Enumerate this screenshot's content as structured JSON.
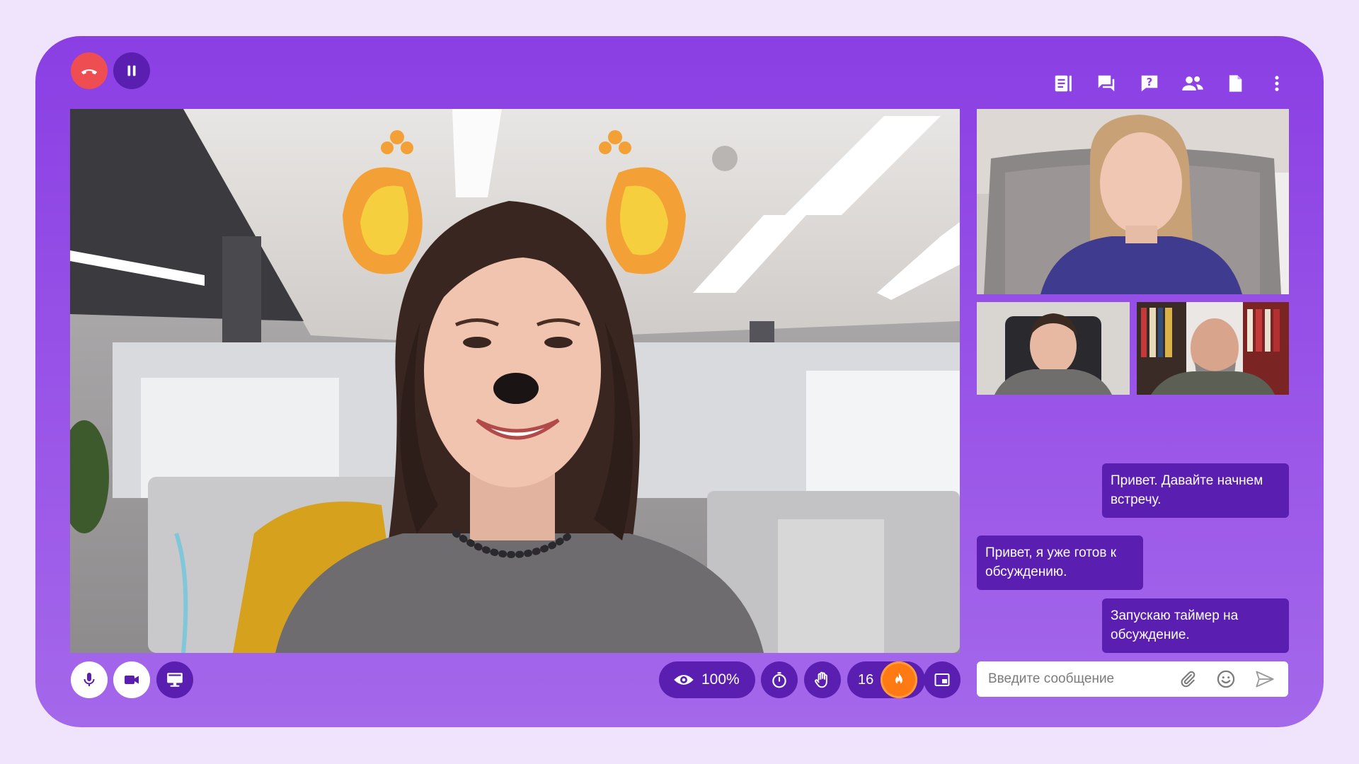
{
  "header": {
    "left_buttons": [
      {
        "name": "end-call-button",
        "icon": "phone-hangup-icon",
        "color": "#ee4d52"
      },
      {
        "name": "pause-button",
        "icon": "pause-icon"
      }
    ],
    "right_icons": [
      "notes-icon",
      "chat-icon",
      "help-icon",
      "participants-icon",
      "document-icon",
      "more-vertical-icon"
    ]
  },
  "chat": {
    "messages": [
      {
        "text": "Привет. Давайте начнем встречу.",
        "side": "right"
      },
      {
        "text": "Привет, я уже готов к обсуждению.",
        "side": "left"
      },
      {
        "text": "Запускаю таймер на обсуждение.",
        "side": "right"
      }
    ],
    "input": {
      "value": "",
      "placeholder": "Введите сообщение"
    }
  },
  "controls": {
    "left": [
      "microphone-icon",
      "camera-icon",
      "screen-share-icon"
    ],
    "view_percent_label": "100%",
    "reactions_count": "16"
  },
  "colors": {
    "accent": "#8a3fe3",
    "dark_button": "#5a1fb0",
    "end_call": "#ee4d52",
    "fire": "#ff7a12",
    "page_bg": "#efe4fc"
  }
}
